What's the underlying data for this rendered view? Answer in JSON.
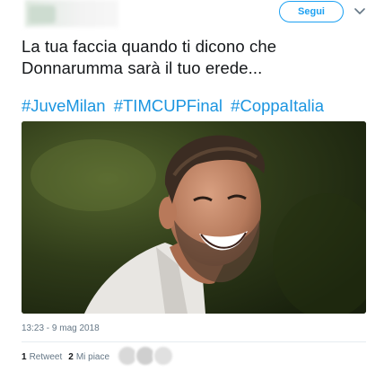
{
  "header": {
    "follow_label": "Segui",
    "menu_icon": "chevron-down-icon"
  },
  "tweet": {
    "text_line1": "La tua faccia quando ti dicono che",
    "text_line2": "Donnarumma sarà il tuo erede...",
    "hashtags": [
      "#JuveMilan",
      "#TIMCUPFinal",
      "#CoppaItalia"
    ],
    "timestamp": "13:23 - 9 mag 2018"
  },
  "stats": {
    "retweet_count": "1",
    "retweet_label": "Retweet",
    "like_count": "2",
    "like_label": "Mi piace"
  },
  "colors": {
    "accent": "#1da1f2",
    "hashtag": "#1b95e0",
    "muted": "#657786",
    "text": "#14171a"
  }
}
